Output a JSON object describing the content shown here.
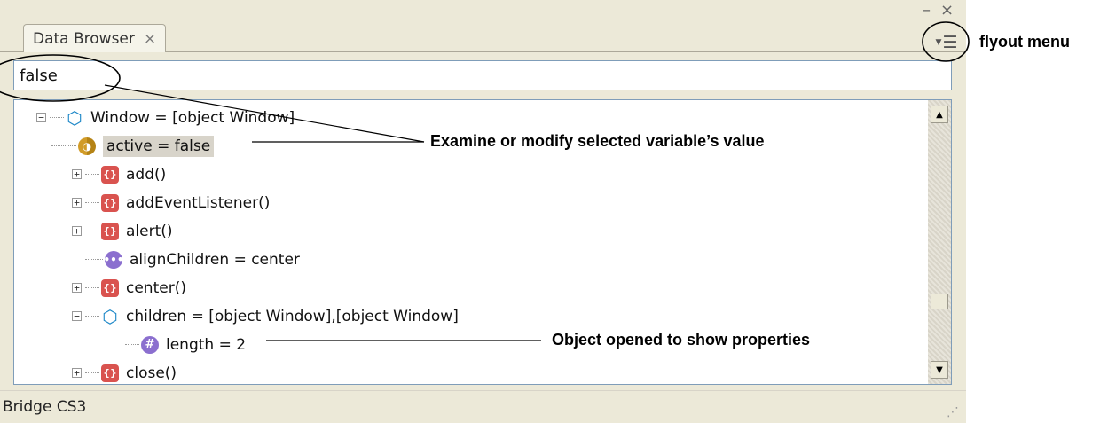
{
  "panel": {
    "tab_label": "Data Browser",
    "tab_close_glyph": "×",
    "window_minimize_glyph": "–",
    "window_close_glyph": "×",
    "flyout_icon": "flyout-menu-icon",
    "value_field": "false",
    "status": "Bridge CS3"
  },
  "tree": [
    {
      "label": "Window = [object Window]",
      "icon": "object-icon",
      "expander": "−"
    },
    {
      "label": "active = false",
      "icon": "boolean-icon",
      "selected": true
    },
    {
      "label": "add()",
      "icon": "function-icon",
      "expander": "+"
    },
    {
      "label": "addEventListener()",
      "icon": "function-icon",
      "expander": "+"
    },
    {
      "label": "alert()",
      "icon": "function-icon",
      "expander": "+"
    },
    {
      "label": "alignChildren = center",
      "icon": "enum-icon"
    },
    {
      "label": "center()",
      "icon": "function-icon",
      "expander": "+"
    },
    {
      "label": "children = [object Window],[object Window]",
      "icon": "object-icon",
      "expander": "−"
    },
    {
      "label": "length = 2",
      "icon": "number-icon"
    },
    {
      "label": "close()",
      "icon": "function-icon",
      "expander": "+"
    }
  ],
  "callouts": {
    "flyout": "flyout menu",
    "examine": "Examine or modify selected variable’s value",
    "opened": "Object opened to show properties"
  },
  "colors": {
    "panel_bg": "#ece9d8",
    "border": "#7f9db9",
    "function_icon": "#d9534f",
    "object_icon": "#1e88c8"
  }
}
